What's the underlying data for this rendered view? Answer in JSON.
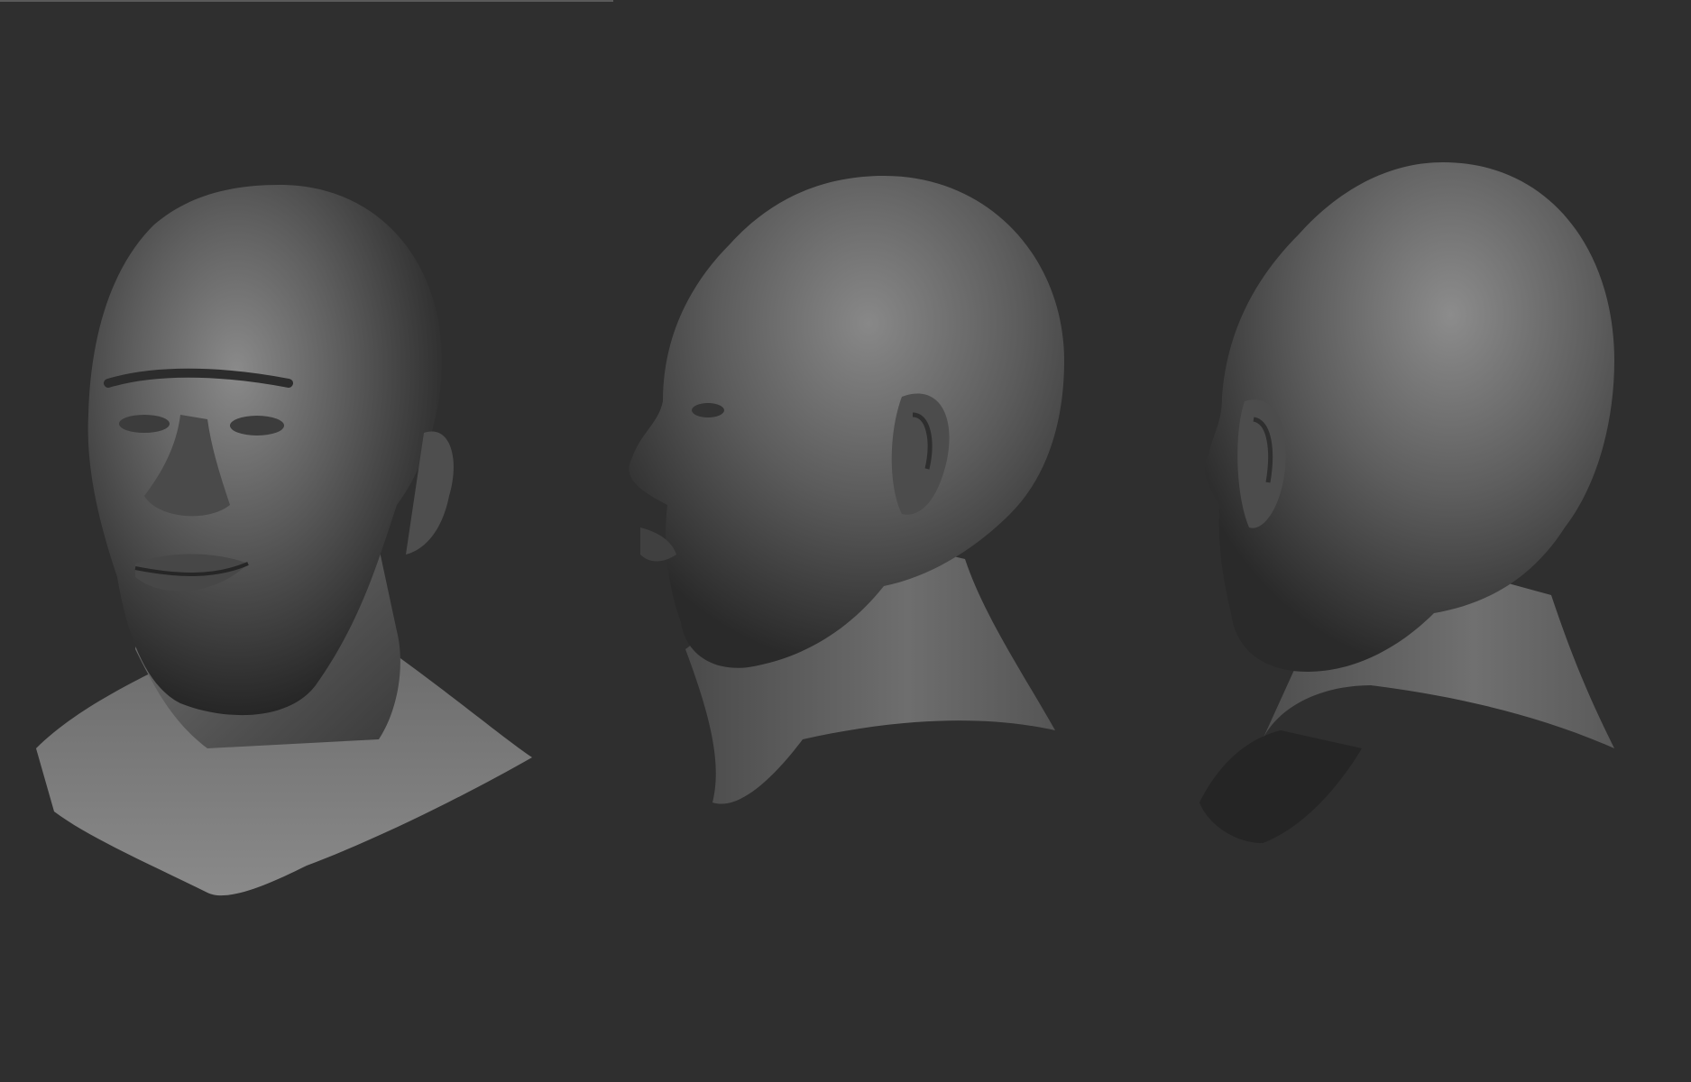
{
  "scene": {
    "background_color": "#2f2f2f",
    "clay_color": "#6e6e6e",
    "views": [
      {
        "id": "front-three-quarter",
        "icon": "sculpted-head-front"
      },
      {
        "id": "left-profile",
        "icon": "sculpted-head-profile"
      },
      {
        "id": "rear-three-quarter",
        "icon": "sculpted-head-back"
      }
    ]
  }
}
